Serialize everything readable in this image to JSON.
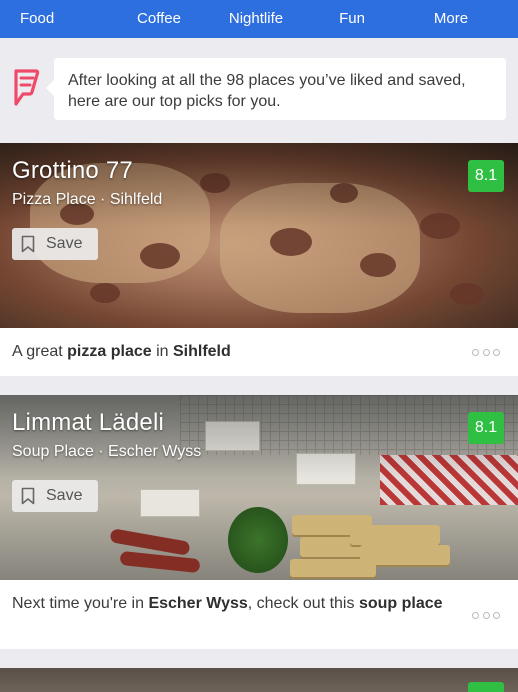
{
  "nav": {
    "items": [
      "Food",
      "Coffee",
      "Nightlife",
      "Fun",
      "More"
    ]
  },
  "intro": {
    "message": "After looking at all the 98 places you’ve liked and saved, here are our top picks for you.",
    "logo_icon": "foursquare-logo-icon",
    "logo_color": "#f04a6a"
  },
  "venues": [
    {
      "name": "Grottino 77",
      "category": "Pizza Place · Sihlfeld",
      "score": "8.1",
      "save_label": "Save",
      "reason_prefix": "A great ",
      "reason_bold1": "pizza place",
      "reason_mid": " in ",
      "reason_bold2": "Sihlfeld",
      "reason_suffix": ""
    },
    {
      "name": "Limmat Lädeli",
      "category": "Soup Place · Escher Wyss",
      "score": "8.1",
      "save_label": "Save",
      "reason_prefix": "Next time you're in ",
      "reason_bold1": "Escher Wyss",
      "reason_mid": ", check out this ",
      "reason_bold2": "soup place",
      "reason_suffix": ""
    }
  ],
  "colors": {
    "nav_bg": "#2e6fe0",
    "score_bg": "#2fbf43",
    "page_bg": "#ececf0"
  }
}
